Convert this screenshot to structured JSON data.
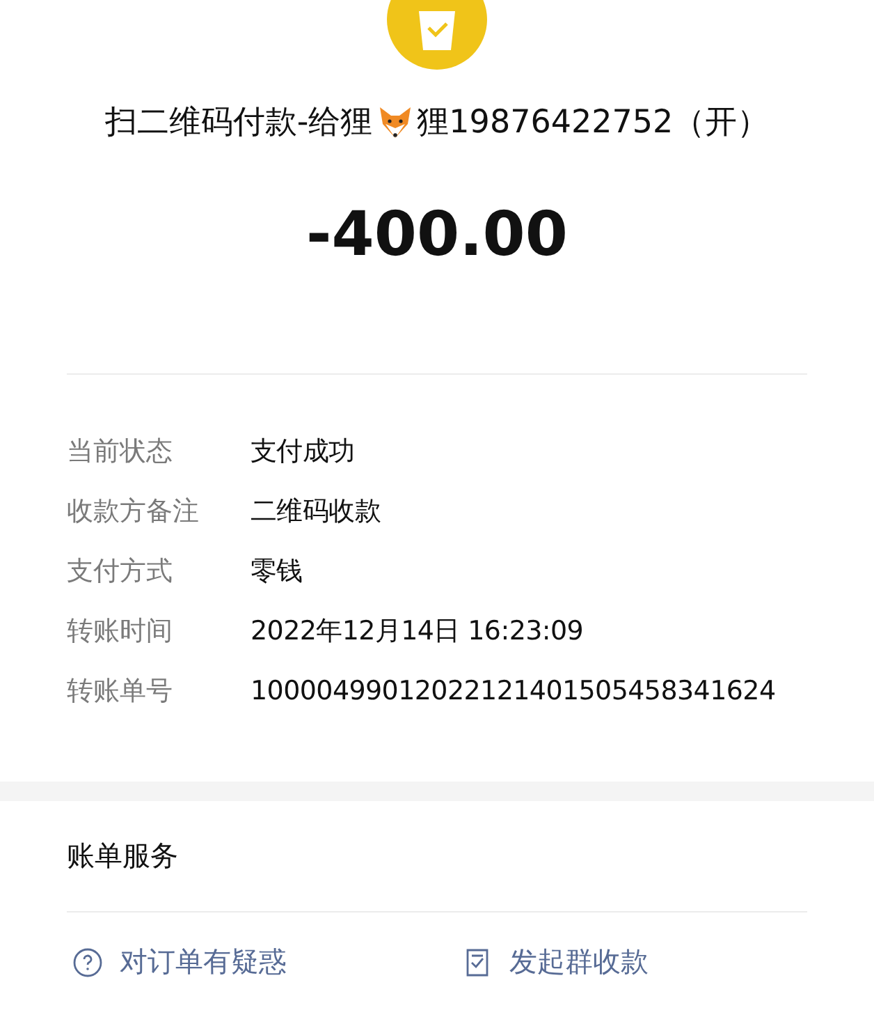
{
  "payment": {
    "title_before": "扫二维码付款-给狸",
    "title_after": "狸19876422752（开）",
    "amount": "-400.00"
  },
  "details": [
    {
      "label": "当前状态",
      "value": "支付成功"
    },
    {
      "label": "收款方备注",
      "value": "二维码收款"
    },
    {
      "label": "支付方式",
      "value": "零钱"
    },
    {
      "label": "转账时间",
      "value": "2022年12月14日 16:23:09"
    },
    {
      "label": "转账单号",
      "value": "10000499012022121401505458341624"
    }
  ],
  "services": {
    "title": "账单服务",
    "actions": [
      {
        "kind": "question",
        "label": "对订单有疑惑"
      },
      {
        "kind": "document",
        "label": "发起群收款"
      }
    ]
  }
}
